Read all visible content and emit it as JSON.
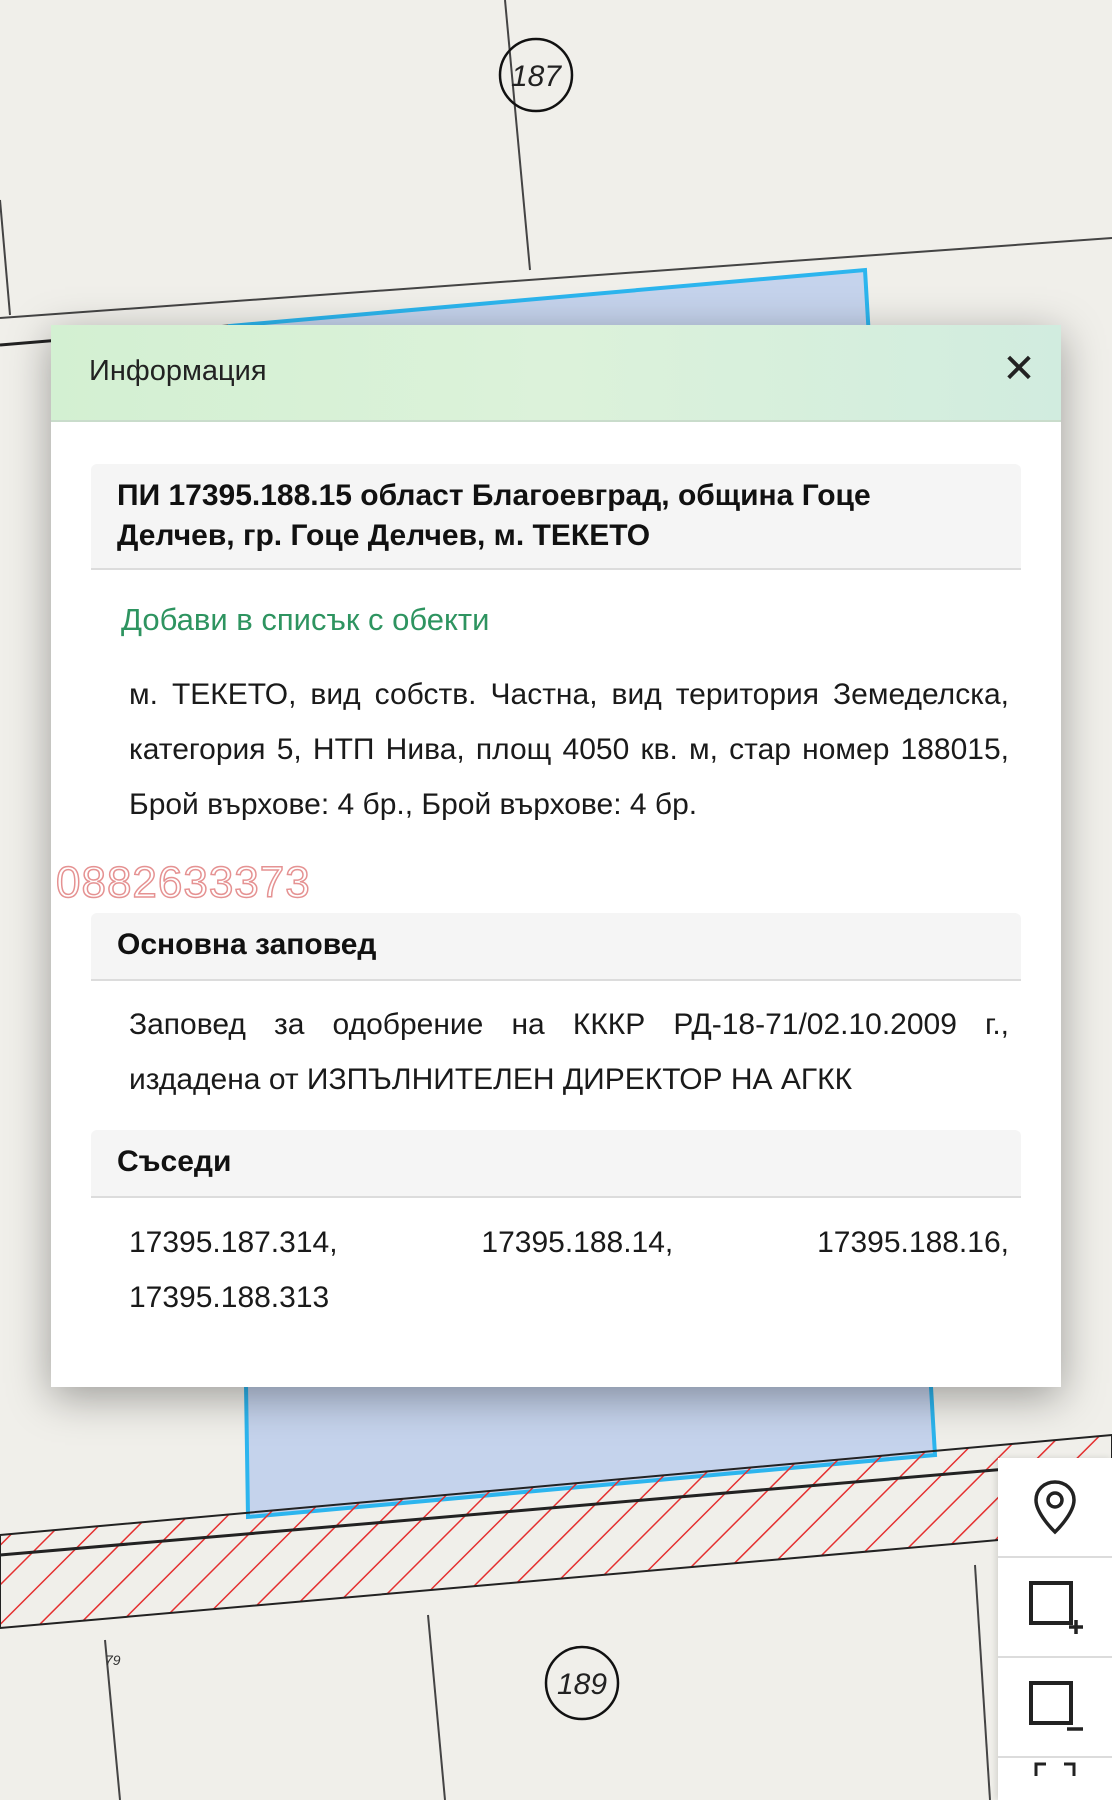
{
  "map": {
    "block_labels": [
      "187",
      "189"
    ],
    "small_label": "79",
    "parcel_fill": "#c5d3ec",
    "parcel_stroke": "#2cb5ee",
    "hatch_color": "#e43030"
  },
  "dialog": {
    "title": "Информация",
    "close_icon": "close-icon",
    "parcel_heading": "ПИ 17395.188.15 област Благоевград, община Гоце Делчев, гр. Гоце Делчев, м. ТЕКЕТО",
    "add_to_list_label": "Добави в списък с обекти",
    "parcel_description": "м. ТЕКЕТО, вид собств. Частна, вид територия Земеделска, категория 5, НТП Нива, площ 4050 кв. м, стар номер 188015, Брой върхове: 4 бр., Брой върхове: 4 бр.",
    "order_heading": "Основна заповед",
    "order_text": "Заповед за одобрение на КККР РД-18-71/02.10.2009 г., издадена от ИЗПЪЛНИТЕЛЕН ДИРЕКТОР НА АГКК",
    "neighbors_heading": "Съседи",
    "neighbors": [
      "17395.187.314,",
      "17395.188.14,",
      "17395.188.16,",
      "17395.188.313"
    ]
  },
  "watermark": "0882633373",
  "toolbar": {
    "items": [
      "location-pin-icon",
      "add-rectangle-icon",
      "remove-rectangle-icon"
    ]
  },
  "colors": {
    "accent_green": "#2e9460",
    "header_gradient": "#d3f0d2"
  }
}
